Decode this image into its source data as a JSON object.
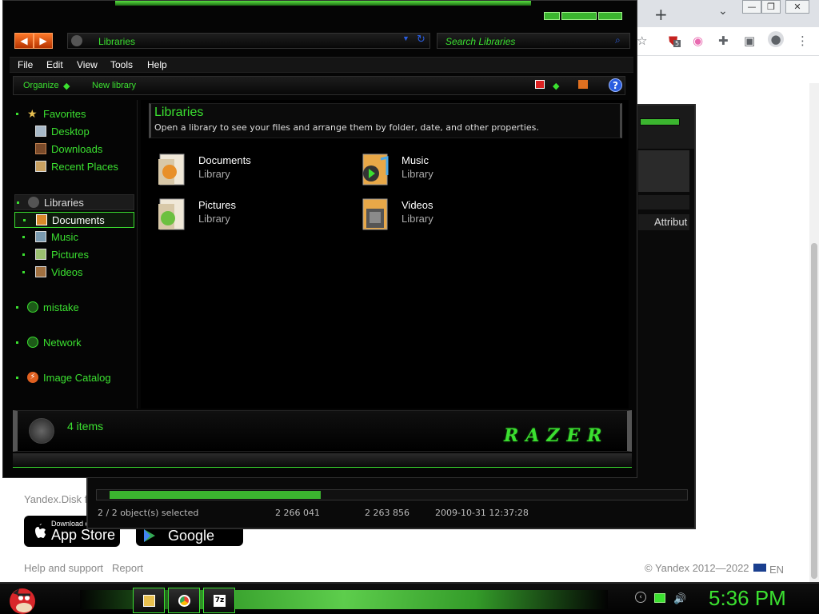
{
  "browser": {
    "new_tab": "+",
    "tab_dropdown": "⌄",
    "window_controls": {
      "minimize": "—",
      "restore": "❐",
      "close": "✕"
    },
    "ext_badge": "5",
    "yandex_disk_text": "Yandex.Disk f",
    "app_store": {
      "small": "Download on the",
      "big": "App Store"
    },
    "google_play": {
      "small": "",
      "big": "Google Play"
    },
    "footer": {
      "help": "Help and support",
      "report": "Report",
      "copyright": "© Yandex 2012—2022",
      "lang": "EN"
    }
  },
  "bg_window": {
    "column_header": "Attribut",
    "status": {
      "selection": "2 / 2 object(s) selected",
      "size1": "2 266 041",
      "size2": "2 263 856",
      "date": "2009-10-31 12:37:28"
    }
  },
  "explorer": {
    "address": "Libraries",
    "search_placeholder": "Search Libraries",
    "menu": [
      "File",
      "Edit",
      "View",
      "Tools",
      "Help"
    ],
    "commands": {
      "organize": "Organize",
      "new_library": "New library"
    },
    "help": "?",
    "sidebar": {
      "favorites": "Favorites",
      "favorite_items": [
        "Desktop",
        "Downloads",
        "Recent Places"
      ],
      "libraries": "Libraries",
      "library_items": [
        "Documents",
        "Music",
        "Pictures",
        "Videos"
      ],
      "selected": "Documents",
      "other": [
        "mistake",
        "Network",
        "Image Catalog"
      ]
    },
    "content": {
      "title": "Libraries",
      "description": "Open a library to see your files and arrange them by folder, date, and other properties.",
      "libraries": [
        {
          "name": "Documents",
          "type": "Library"
        },
        {
          "name": "Music",
          "type": "Library"
        },
        {
          "name": "Pictures",
          "type": "Library"
        },
        {
          "name": "Videos",
          "type": "Library"
        }
      ]
    },
    "status": {
      "count": "4 items",
      "brand": "RAZER"
    }
  },
  "taskbar": {
    "clock": "5:36 PM",
    "app3_label": "7z"
  },
  "colors": {
    "accent": "#3be030",
    "background": "#050505"
  }
}
